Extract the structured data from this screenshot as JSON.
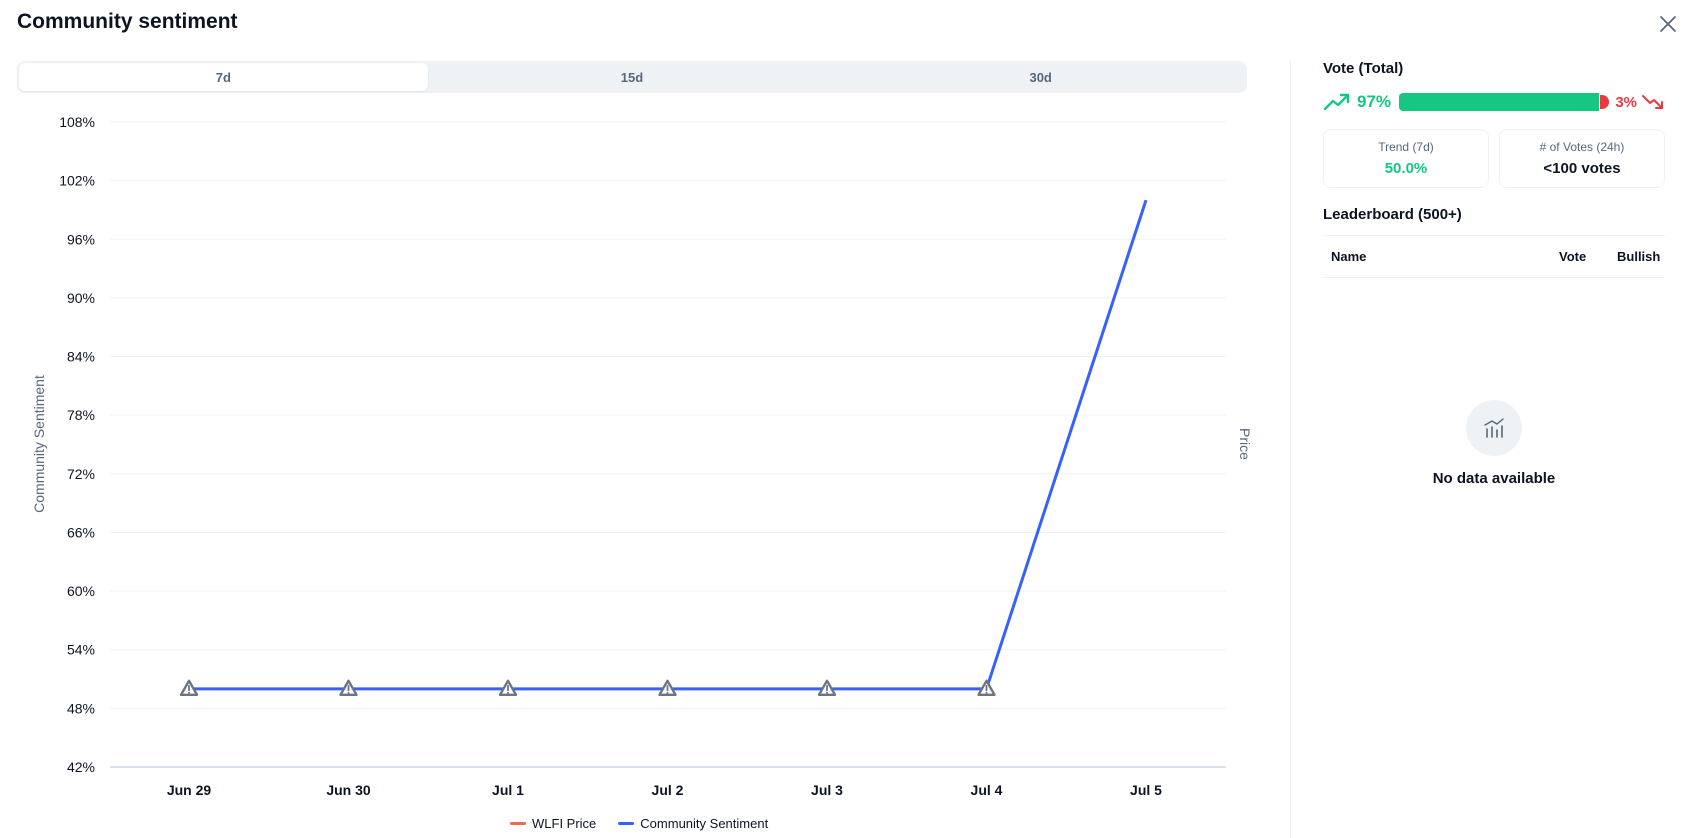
{
  "header": {
    "title": "Community sentiment",
    "close_icon": "close-icon"
  },
  "tabs": [
    {
      "label": "7d",
      "active": true
    },
    {
      "label": "15d",
      "active": false
    },
    {
      "label": "30d",
      "active": false
    }
  ],
  "chart_data": {
    "type": "line",
    "ylabel": "Community Sentiment",
    "y2label": "Price",
    "yticks": [
      "108%",
      "102%",
      "96%",
      "90%",
      "84%",
      "78%",
      "72%",
      "66%",
      "60%",
      "54%",
      "48%",
      "42%"
    ],
    "ylim": [
      42,
      108
    ],
    "categories": [
      "Jun 29",
      "Jun 30",
      "Jul 1",
      "Jul 2",
      "Jul 3",
      "Jul 4",
      "Jul 5"
    ],
    "highlighted_category": "Jul 5",
    "grid": true,
    "legend_position": "bottom",
    "series": [
      {
        "name": "WLFI Price",
        "color": "#f0694a",
        "values": []
      },
      {
        "name": "Community Sentiment",
        "color": "#3861fb",
        "values": [
          50,
          50,
          50,
          50,
          50,
          50,
          100
        ],
        "warning_markers": [
          true,
          true,
          true,
          true,
          true,
          true,
          false
        ]
      }
    ]
  },
  "vote": {
    "title": "Vote (Total)",
    "bullish_pct": "97%",
    "bearish_pct": "3%",
    "bullish_fraction": 0.97,
    "bullish_color": "#16c784",
    "bearish_color": "#ea3943"
  },
  "stats": {
    "trend_label": "Trend (7d)",
    "trend_value": "50.0%",
    "votes_label": "# of Votes (24h)",
    "votes_value": "<100 votes"
  },
  "leaderboard": {
    "title": "Leaderboard (500+)",
    "columns": {
      "name": "Name",
      "vote": "Vote",
      "bullish": "Bullish"
    },
    "empty_text": "No data available"
  }
}
